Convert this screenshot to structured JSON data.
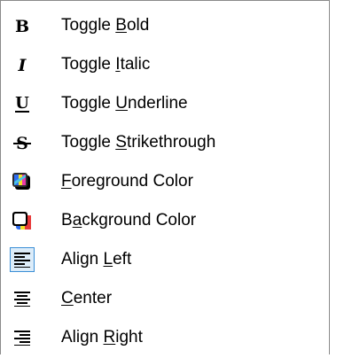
{
  "menu": {
    "items": [
      {
        "icon": "bold-icon",
        "pre": "Toggle ",
        "key": "B",
        "post": "old",
        "active": false
      },
      {
        "icon": "italic-icon",
        "pre": "Toggle ",
        "key": "I",
        "post": "talic",
        "active": false
      },
      {
        "icon": "underline-icon",
        "pre": "Toggle ",
        "key": "U",
        "post": "nderline",
        "active": false
      },
      {
        "icon": "strikethrough-icon",
        "pre": "Toggle ",
        "key": "S",
        "post": "trikethrough",
        "active": false
      },
      {
        "icon": "foreground-color-icon",
        "pre": "",
        "key": "F",
        "post": "oreground Color",
        "active": false
      },
      {
        "icon": "background-color-icon",
        "pre": "B",
        "key": "a",
        "post": "ckground Color",
        "active": false
      },
      {
        "icon": "align-left-icon",
        "pre": "Align ",
        "key": "L",
        "post": "eft",
        "active": true
      },
      {
        "icon": "align-center-icon",
        "pre": "",
        "key": "C",
        "post": "enter",
        "active": false
      },
      {
        "icon": "align-right-icon",
        "pre": "Align ",
        "key": "R",
        "post": "ight",
        "active": false
      }
    ]
  }
}
